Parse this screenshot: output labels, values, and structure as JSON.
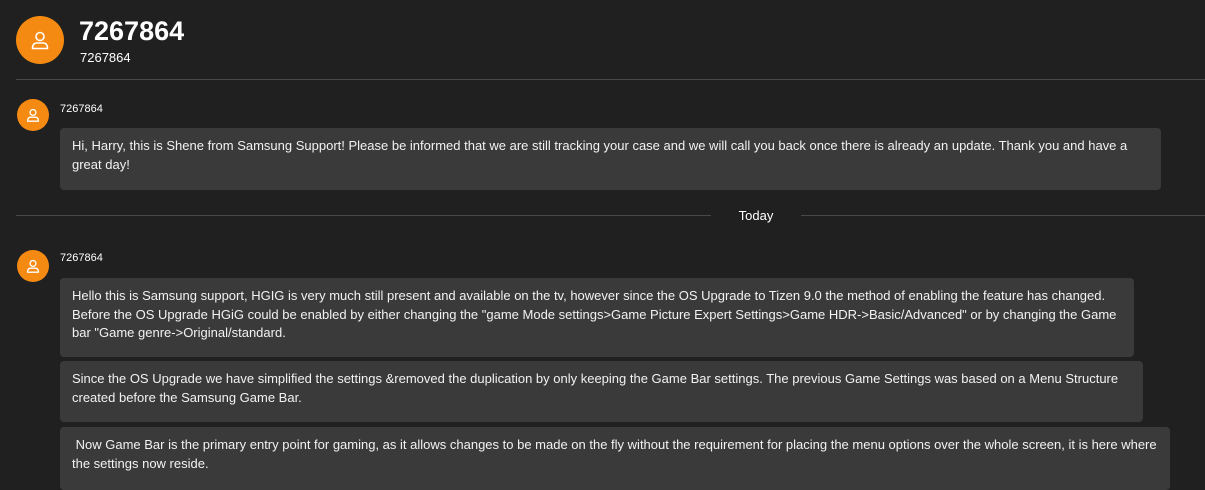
{
  "header": {
    "title": "7267864",
    "subtitle": "7267864",
    "avatar_icon": "person-icon",
    "accent": "#f58a12"
  },
  "messages": [
    {
      "sender": "7267864",
      "avatar_icon": "person-icon",
      "bubbles": [
        "Hi, Harry, this is Shene from Samsung Support! Please be informed that we are still tracking your case and we will call you back once there is already an update. Thank you and have a great day!"
      ]
    },
    {
      "sender": "7267864",
      "avatar_icon": "person-icon",
      "bubbles": [
        "Hello this is Samsung support, HGIG is very much still present and available on the tv, however since the OS Upgrade to Tizen 9.0 the method of enabling the feature has changed. Before the OS Upgrade HGiG could be enabled by either changing the \"game Mode settings>Game Picture Expert Settings>Game HDR->Basic/Advanced\" or by changing the Game bar \"Game genre->Original/standard.",
        "Since the OS Upgrade we have simplified the settings &removed the duplication by only keeping the Game Bar settings. The previous Game Settings was based on a  Menu Structure created before the Samsung Game Bar.",
        " Now Game Bar is the primary entry point for gaming, as it allows changes to be made on the fly without the requirement for placing the menu options over the whole screen, it is here where the settings now reside."
      ]
    }
  ],
  "day_separator": "Today"
}
